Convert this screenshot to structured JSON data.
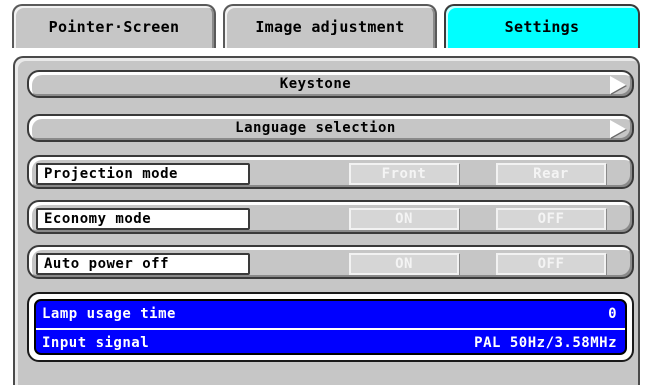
{
  "tabs": [
    {
      "label": "Pointer·Screen",
      "active": false
    },
    {
      "label": "Image adjustment",
      "active": false
    },
    {
      "label": "Settings",
      "active": true
    }
  ],
  "menu": {
    "keystone": "Keystone",
    "language": "Language selection"
  },
  "options": [
    {
      "label": "Projection mode",
      "choices": [
        "Front",
        "Rear"
      ]
    },
    {
      "label": "Economy mode",
      "choices": [
        "ON",
        "OFF"
      ]
    },
    {
      "label": "Auto power off",
      "choices": [
        "ON",
        "OFF"
      ]
    }
  ],
  "info": {
    "lamp_label": "Lamp usage time",
    "lamp_value": "0",
    "signal_label": "Input signal",
    "signal_value": "PAL 50Hz/3.58MHz"
  },
  "colors": {
    "panel": "#c6c6c6",
    "active_tab": "#00ffff",
    "info_bg": "#0000ff"
  },
  "icons": {
    "submenu": "right-arrow-icon"
  }
}
